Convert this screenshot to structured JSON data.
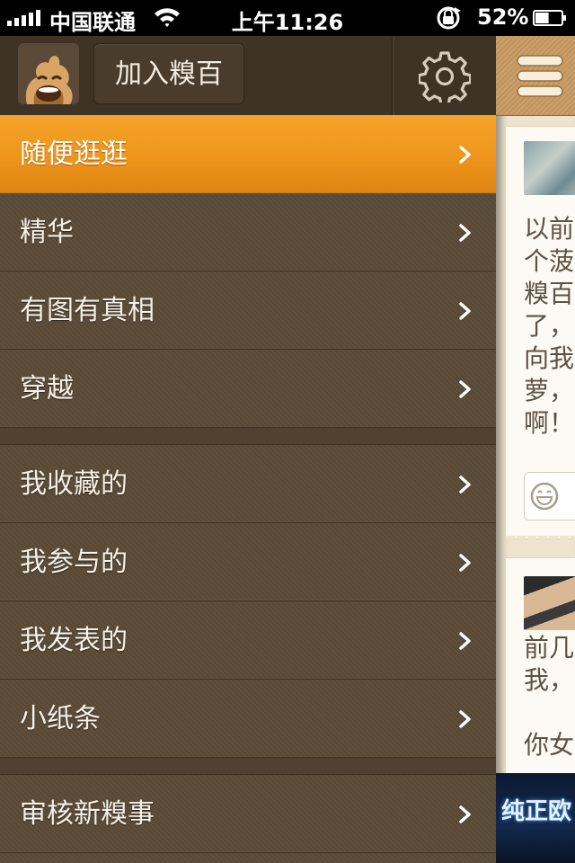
{
  "status_bar": {
    "carrier": "中国联通",
    "time": "上午11:26",
    "battery_percent": "52%",
    "signal_bars": 5,
    "battery_level": 0.52
  },
  "header": {
    "join_button_label": "加入糗百",
    "avatar_icon": "poop-mascot-icon",
    "settings_icon": "gear-icon"
  },
  "menu": {
    "sections": [
      {
        "items": [
          {
            "label": "随便逛逛",
            "active": true
          },
          {
            "label": "精华",
            "active": false
          },
          {
            "label": "有图有真相",
            "active": false
          },
          {
            "label": "穿越",
            "active": false
          }
        ]
      },
      {
        "items": [
          {
            "label": "我收藏的",
            "active": false
          },
          {
            "label": "我参与的",
            "active": false
          },
          {
            "label": "我发表的",
            "active": false
          },
          {
            "label": "小纸条",
            "active": false
          }
        ]
      },
      {
        "items": [
          {
            "label": "审核新糗事",
            "active": false
          }
        ]
      }
    ]
  },
  "content": {
    "menu_toggle_icon": "hamburger-menu-icon",
    "cards": [
      {
        "text": "以前\n个菠\n糗百\n了，\n向我\n萝，\n啊！"
      },
      {
        "text": "前几\n我，\n\n你女"
      }
    ],
    "ad_text": "纯正欧"
  },
  "colors": {
    "menu_bg": "#5a4a37",
    "active_item": "#f09a20",
    "header_bg": "#3f3326",
    "content_bg": "#ede3cf"
  }
}
